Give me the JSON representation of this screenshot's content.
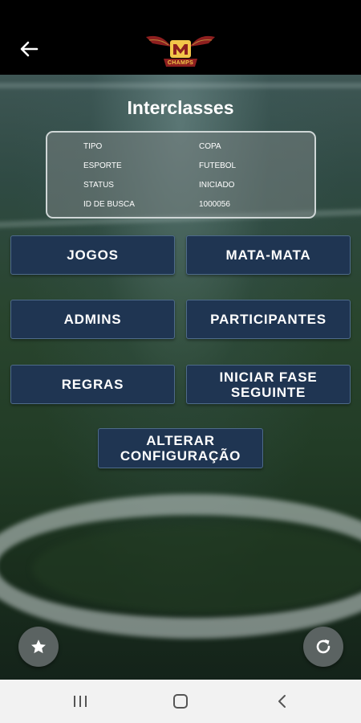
{
  "header": {
    "back_icon": "arrow-left-icon",
    "logo_text": "CHAMPS"
  },
  "page": {
    "title": "Interclasses"
  },
  "info": {
    "rows": [
      {
        "key": "TIPO",
        "value": "COPA"
      },
      {
        "key": "ESPORTE",
        "value": "FUTEBOL"
      },
      {
        "key": "STATUS",
        "value": "INICIADO"
      },
      {
        "key": "ID DE BUSCA",
        "value": "1000056"
      }
    ]
  },
  "buttons": {
    "jogos": "JOGOS",
    "mata_mata": "MATA-MATA",
    "admins": "ADMINS",
    "participantes": "PARTICIPANTES",
    "regras": "REGRAS",
    "iniciar_fase_line1": "INICIAR FASE",
    "iniciar_fase_line2": "SEGUINTE",
    "alterar_line1": "ALTERAR",
    "alterar_line2": "CONFIGURAÇÃO"
  },
  "fabs": {
    "favorite_icon": "star-icon",
    "refresh_icon": "refresh-icon"
  },
  "navbar": {
    "recents_icon": "recents-icon",
    "home_icon": "home-icon",
    "back_icon": "back-chevron-icon"
  },
  "colors": {
    "button_bg": "#1f3552",
    "button_border": "#4e6b8a",
    "logo_accent": "#f3c64a",
    "logo_red": "#8e1f1f"
  }
}
